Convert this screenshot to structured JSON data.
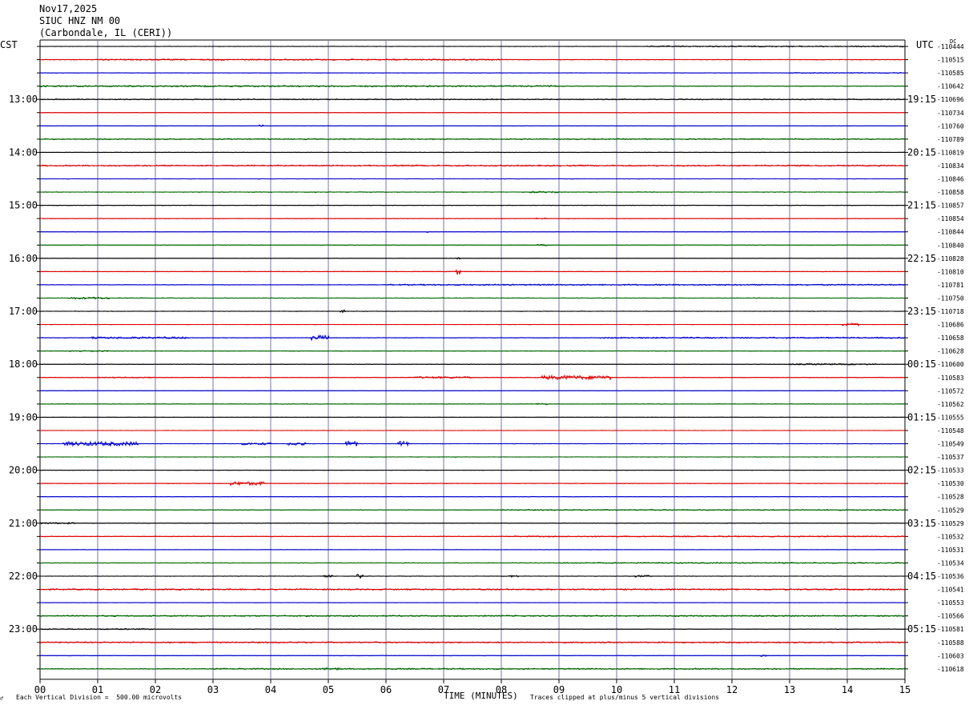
{
  "header": {
    "date": "Nov17,2025",
    "station": "SIUC HNZ NM 00",
    "location": "(Carbondale, IL (CERI))"
  },
  "left_zone": "CST",
  "right_zone": "UTC",
  "dc_label": "DC",
  "footer": {
    "scale_note": "Each Vertical Division =  500.00 microvolts",
    "clip_note": "Traces clipped at plus/minus 5 vertical divisions",
    "mark": "♂"
  },
  "colors": {
    "black": "#000000",
    "red": "#dd0000",
    "blue": "#0000cc",
    "green": "#006600",
    "grid": "#7777aa"
  },
  "chart_data": {
    "type": "helicorder",
    "xlabel": "TIME (MINUTES)",
    "x_ticks": [
      "00",
      "01",
      "02",
      "03",
      "04",
      "05",
      "06",
      "07",
      "08",
      "09",
      "10",
      "11",
      "12",
      "13",
      "14",
      "15"
    ],
    "xlim": [
      0,
      15
    ],
    "trace_minutes": 15,
    "trace_color_cycle": [
      "black",
      "red",
      "blue",
      "green"
    ],
    "hour_labels_cst": [
      "13:00",
      "14:00",
      "15:00",
      "16:00",
      "17:00",
      "18:00",
      "19:00",
      "20:00",
      "21:00",
      "22:00",
      "23:00"
    ],
    "hour_labels_utc": [
      "19:15",
      "20:15",
      "21:15",
      "22:15",
      "23:15",
      "00:15",
      "01:15",
      "02:15",
      "03:15",
      "04:15",
      "05:15"
    ],
    "hour_label_first_trace": 4,
    "dc_offsets": [
      "-110444",
      "-110515",
      "-110585",
      "-110642",
      "-110696",
      "-110734",
      "-110760",
      "-110789",
      "-110819",
      "-110834",
      "-110846",
      "-110858",
      "-110857",
      "-110854",
      "-110844",
      "-110840",
      "-110828",
      "-110810",
      "-110781",
      "-110750",
      "-110718",
      "-110686",
      "-110658",
      "-110628",
      "-110600",
      "-110583",
      "-110572",
      "-110562",
      "-110555",
      "-110548",
      "-110549",
      "-110537",
      "-110533",
      "-110530",
      "-110528",
      "-110529",
      "-110529",
      "-110532",
      "-110531",
      "-110534",
      "-110536",
      "-110541",
      "-110553",
      "-110566",
      "-110581",
      "-110588",
      "-110603",
      "-110618"
    ],
    "trace_activity": [
      {
        "noise": 0.25,
        "segments": [
          [
            10.5,
            15,
            0.7
          ]
        ]
      },
      {
        "noise": 0.4,
        "segments": [
          [
            1,
            8,
            0.8
          ]
        ]
      },
      {
        "noise": 0.3,
        "segments": [
          [
            13,
            15,
            0.6
          ]
        ]
      },
      {
        "noise": 0.4,
        "segments": [
          [
            0,
            9,
            0.9
          ]
        ]
      },
      {
        "noise": 0.35,
        "segments": [
          [
            0,
            15,
            0.6
          ]
        ]
      },
      {
        "noise": 0.3,
        "segments": []
      },
      {
        "noise": 0.25,
        "segments": [
          [
            3.8,
            3.9,
            1.5
          ]
        ]
      },
      {
        "noise": 0.45,
        "segments": [
          [
            0,
            15,
            0.7
          ]
        ]
      },
      {
        "noise": 0.3,
        "segments": []
      },
      {
        "noise": 0.5,
        "segments": [
          [
            0,
            15,
            0.8
          ]
        ]
      },
      {
        "noise": 0.25,
        "segments": []
      },
      {
        "noise": 0.4,
        "segments": [
          [
            8.5,
            9,
            1.0
          ]
        ]
      },
      {
        "noise": 0.3,
        "segments": []
      },
      {
        "noise": 0.3,
        "segments": [
          [
            8.6,
            8.8,
            1.0
          ]
        ]
      },
      {
        "noise": 0.2,
        "segments": [
          [
            6.7,
            6.75,
            1.0
          ]
        ]
      },
      {
        "noise": 0.3,
        "segments": [
          [
            8.6,
            8.8,
            1.0
          ]
        ]
      },
      {
        "noise": 0.2,
        "segments": [
          [
            7.2,
            7.3,
            1.0
          ]
        ]
      },
      {
        "noise": 0.3,
        "segments": [
          [
            7.2,
            7.3,
            4.0
          ]
        ]
      },
      {
        "noise": 0.3,
        "segments": [
          [
            6,
            15,
            0.8
          ]
        ]
      },
      {
        "noise": 0.35,
        "segments": [
          [
            0.5,
            1.2,
            1.2
          ]
        ]
      },
      {
        "noise": 0.3,
        "segments": [
          [
            5.2,
            5.3,
            1.5
          ]
        ]
      },
      {
        "noise": 0.2,
        "segments": [
          [
            13.9,
            14.2,
            1.6
          ]
        ]
      },
      {
        "noise": 0.35,
        "segments": [
          [
            0.9,
            2.6,
            1.2
          ],
          [
            4.7,
            5.0,
            3.0
          ],
          [
            9.7,
            15,
            0.8
          ]
        ]
      },
      {
        "noise": 0.3,
        "segments": [
          [
            0.5,
            1.2,
            0.9
          ]
        ]
      },
      {
        "noise": 0.3,
        "segments": [
          [
            13,
            14.5,
            0.8
          ]
        ]
      },
      {
        "noise": 0.4,
        "segments": [
          [
            1,
            2,
            0.7
          ],
          [
            6.5,
            7.5,
            1.2
          ],
          [
            8.7,
            9.9,
            2.5
          ]
        ]
      },
      {
        "noise": 0.2,
        "segments": []
      },
      {
        "noise": 0.3,
        "segments": [
          [
            8.6,
            8.8,
            1.0
          ]
        ]
      },
      {
        "noise": 0.2,
        "segments": []
      },
      {
        "noise": 0.2,
        "segments": []
      },
      {
        "noise": 0.3,
        "segments": [
          [
            0.4,
            1.7,
            2.5
          ],
          [
            3.5,
            4.0,
            1.4
          ],
          [
            4.3,
            4.6,
            2.0
          ],
          [
            5.3,
            5.5,
            3.0
          ],
          [
            6.2,
            6.4,
            3.0
          ]
        ]
      },
      {
        "noise": 0.3,
        "segments": []
      },
      {
        "noise": 0.2,
        "segments": []
      },
      {
        "noise": 0.35,
        "segments": [
          [
            3.3,
            3.9,
            2.2
          ]
        ]
      },
      {
        "noise": 0.3,
        "segments": []
      },
      {
        "noise": 0.35,
        "segments": [
          [
            8,
            15,
            0.7
          ]
        ]
      },
      {
        "noise": 0.3,
        "segments": [
          [
            0,
            0.6,
            1.0
          ]
        ]
      },
      {
        "noise": 0.4,
        "segments": [
          [
            8,
            15,
            0.7
          ]
        ]
      },
      {
        "noise": 0.2,
        "segments": []
      },
      {
        "noise": 0.35,
        "segments": [
          [
            9,
            15,
            0.7
          ]
        ]
      },
      {
        "noise": 0.3,
        "segments": [
          [
            4.9,
            5.1,
            1.2
          ],
          [
            5.5,
            5.6,
            2.8
          ],
          [
            8.1,
            8.3,
            1.2
          ],
          [
            10.3,
            10.6,
            1.2
          ]
        ]
      },
      {
        "noise": 0.45,
        "segments": [
          [
            0,
            15,
            0.8
          ]
        ]
      },
      {
        "noise": 0.2,
        "segments": []
      },
      {
        "noise": 0.45,
        "segments": [
          [
            0,
            15,
            0.8
          ]
        ]
      },
      {
        "noise": 0.3,
        "segments": [
          [
            0,
            2,
            0.7
          ]
        ]
      },
      {
        "noise": 0.45,
        "segments": [
          [
            0,
            15,
            0.8
          ]
        ]
      },
      {
        "noise": 0.3,
        "segments": [
          [
            12.5,
            12.6,
            1.0
          ]
        ]
      },
      {
        "noise": 0.45,
        "segments": [
          [
            3,
            15,
            0.8
          ],
          [
            4.9,
            5.2,
            1.6
          ]
        ]
      }
    ]
  }
}
